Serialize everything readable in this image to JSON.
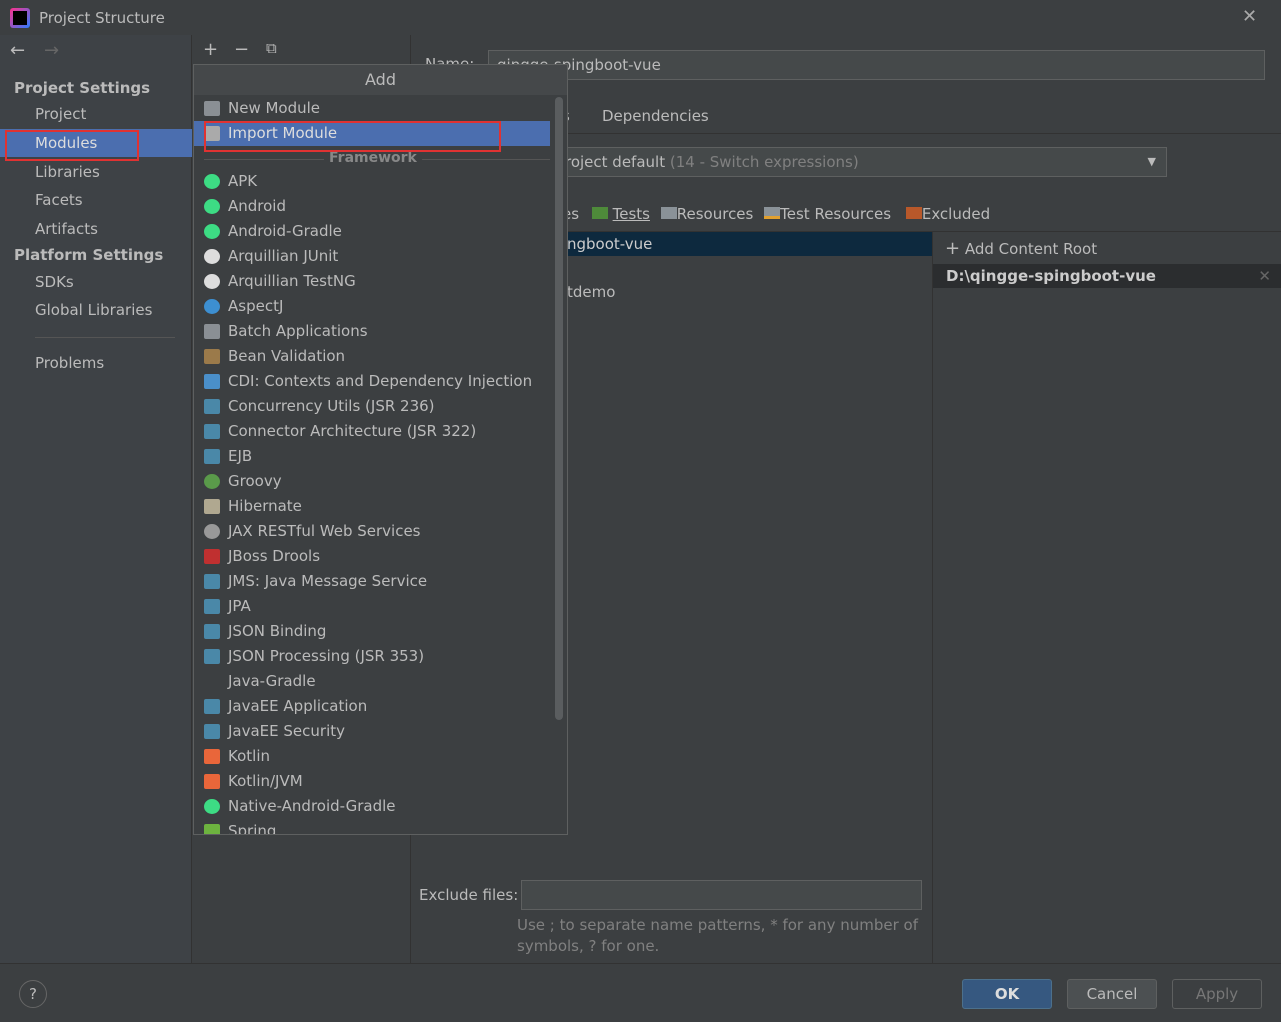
{
  "window": {
    "title": "Project Structure"
  },
  "sidebar": {
    "project_settings": "Project Settings",
    "project_items": [
      "Project",
      "Modules",
      "Libraries",
      "Facets",
      "Artifacts"
    ],
    "platform_settings": "Platform Settings",
    "platform_items": [
      "SDKs",
      "Global Libraries"
    ],
    "problems": "Problems",
    "selected": "Modules"
  },
  "module": {
    "name_label": "Name:",
    "name_value": "qingge-spingboot-vue",
    "tab_sources_fragment": "s",
    "tab_dependencies": "Dependencies",
    "language_level": "roject default",
    "language_level_hint": "(14 - Switch expressions)",
    "marks": {
      "sources_fragment": "es",
      "tests": "Tests",
      "resources": "Resources",
      "test_resources": "Test Resources",
      "excluded": "Excluded"
    },
    "tree": [
      "ngboot-vue",
      "tdemo"
    ],
    "add_content_root": "Add Content Root",
    "content_root_path": "D:\\qingge-spingboot-vue",
    "exclude_label": "Exclude files:",
    "exclude_value": "",
    "hint_line1": "Use ; to separate name patterns, * for any number of",
    "hint_line2": "symbols, ? for one."
  },
  "popup": {
    "title": "Add",
    "framework_label": "Framework",
    "selected": "Import Module",
    "top_items": [
      {
        "label": "New Module",
        "icon": "folder-module-icon",
        "color": "#8a8f94"
      },
      {
        "label": "Import Module",
        "icon": "import-arrow-icon",
        "color": "#aaaaaa"
      }
    ],
    "items": [
      {
        "label": "APK",
        "icon": "android-icon",
        "color": "#3ddc84"
      },
      {
        "label": "Android",
        "icon": "android-icon",
        "color": "#3ddc84"
      },
      {
        "label": "Android-Gradle",
        "icon": "android-icon",
        "color": "#3ddc84"
      },
      {
        "label": "Arquillian JUnit",
        "icon": "arquillian-icon",
        "color": "#dddddd"
      },
      {
        "label": "Arquillian TestNG",
        "icon": "arquillian-icon",
        "color": "#dddddd"
      },
      {
        "label": "AspectJ",
        "icon": "aspectj-icon",
        "color": "#3d8fd1"
      },
      {
        "label": "Batch Applications",
        "icon": "folder-icon",
        "color": "#8a8f94"
      },
      {
        "label": "Bean Validation",
        "icon": "bean-icon",
        "color": "#9b7a4a"
      },
      {
        "label": "CDI: Contexts and Dependency Injection",
        "icon": "cdi-icon",
        "color": "#4a8fc9"
      },
      {
        "label": "Concurrency Utils (JSR 236)",
        "icon": "javaee-icon",
        "color": "#4a88a8"
      },
      {
        "label": "Connector Architecture (JSR 322)",
        "icon": "javaee-icon",
        "color": "#4a88a8"
      },
      {
        "label": "EJB",
        "icon": "javaee-icon",
        "color": "#4a88a8"
      },
      {
        "label": "Groovy",
        "icon": "groovy-icon",
        "color": "#5a9a4a"
      },
      {
        "label": "Hibernate",
        "icon": "hibernate-icon",
        "color": "#b0a890"
      },
      {
        "label": "JAX RESTful Web Services",
        "icon": "globe-icon",
        "color": "#999999"
      },
      {
        "label": "JBoss Drools",
        "icon": "drools-icon",
        "color": "#c03030"
      },
      {
        "label": "JMS: Java Message Service",
        "icon": "javaee-icon",
        "color": "#4a88a8"
      },
      {
        "label": "JPA",
        "icon": "javaee-icon",
        "color": "#4a88a8"
      },
      {
        "label": "JSON Binding",
        "icon": "javaee-icon",
        "color": "#4a88a8"
      },
      {
        "label": "JSON Processing (JSR 353)",
        "icon": "javaee-icon",
        "color": "#4a88a8"
      },
      {
        "label": "Java-Gradle",
        "icon": "none",
        "color": "transparent"
      },
      {
        "label": "JavaEE Application",
        "icon": "javaee-app-icon",
        "color": "#4a88a8"
      },
      {
        "label": "JavaEE Security",
        "icon": "javaee-icon",
        "color": "#4a88a8"
      },
      {
        "label": "Kotlin",
        "icon": "kotlin-icon",
        "color": "#e9663a"
      },
      {
        "label": "Kotlin/JVM",
        "icon": "kotlin-icon",
        "color": "#e9663a"
      },
      {
        "label": "Native-Android-Gradle",
        "icon": "android-icon",
        "color": "#3ddc84"
      },
      {
        "label": "Spring",
        "icon": "spring-leaf-icon",
        "color": "#6db33f"
      }
    ]
  },
  "buttons": {
    "ok": "OK",
    "cancel": "Cancel",
    "apply": "Apply",
    "help": "?"
  },
  "colors": {
    "selection": "#4b6eaf",
    "highlight_box": "#e03232",
    "tree_selection": "#0d293e"
  }
}
